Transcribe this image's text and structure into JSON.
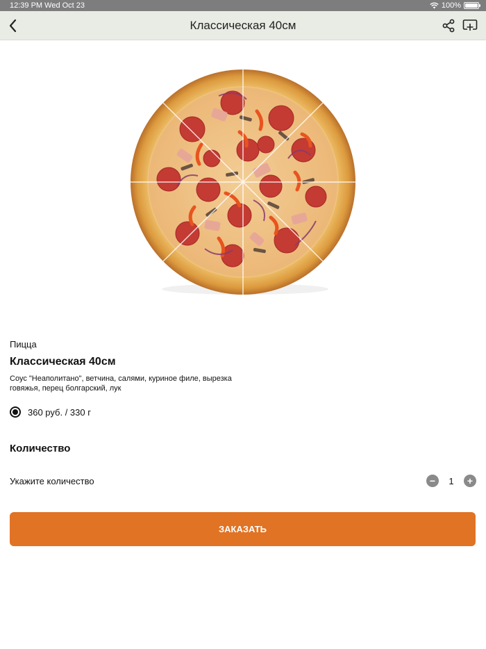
{
  "status_bar": {
    "time": "12:39 PM  Wed Oct 23",
    "battery": "100%"
  },
  "nav": {
    "title": "Классическая 40см"
  },
  "icons": {
    "back": "chevron-left-icon",
    "share": "share-icon",
    "cast": "cast-icon",
    "wifi": "wifi-icon",
    "battery": "battery-icon"
  },
  "product": {
    "category": "Пицца",
    "name": "Классическая 40см",
    "description": "Соус \"Неаполитано\", ветчина, салями, куриное филе, вырезка говяжья, перец болгарский, лук",
    "variant_label": "360 руб. / 330 г"
  },
  "quantity": {
    "heading": "Количество",
    "label": "Укажите количество",
    "value": "1",
    "minus": "−",
    "plus": "+"
  },
  "order_button": {
    "label": "ЗАКАЗАТЬ"
  },
  "colors": {
    "accent": "#e07324",
    "nav_bg": "#e8ece4",
    "status_bg": "#7d7d7d"
  }
}
